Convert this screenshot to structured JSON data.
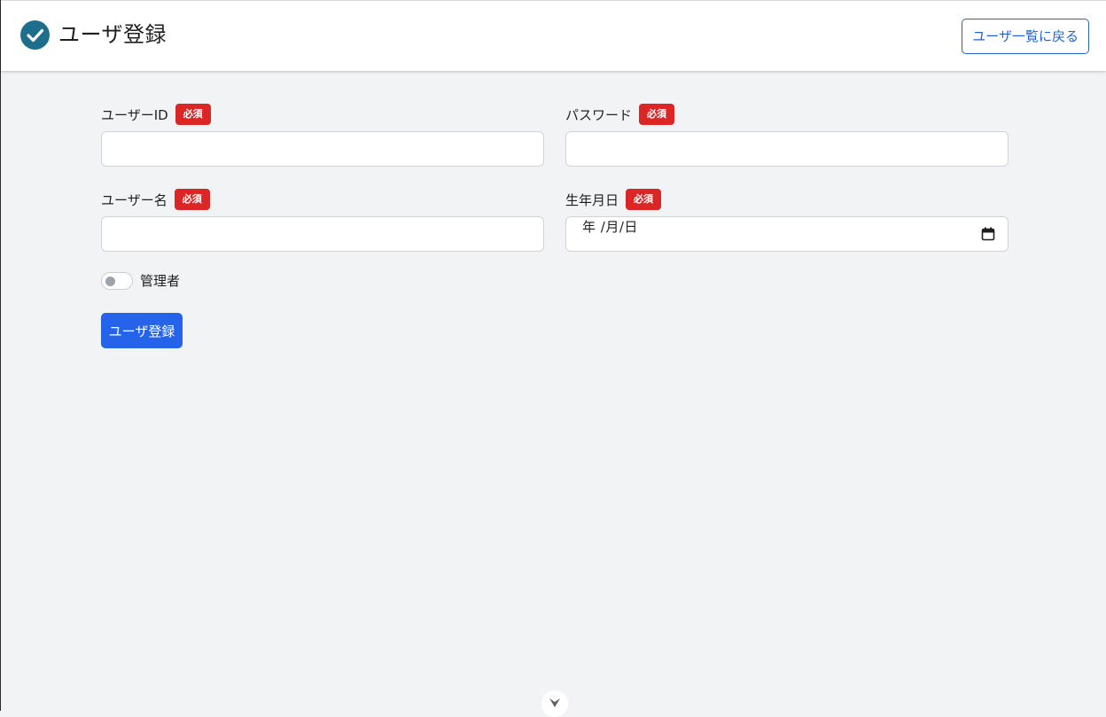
{
  "header": {
    "title": "ユーザ登録",
    "back_button_label": "ユーザ一覧に戻る",
    "icon": "check-circle-icon",
    "accent_color": "#1c6e8c"
  },
  "form": {
    "required_label": "必須",
    "fields": {
      "user_id": {
        "label": "ユーザーID",
        "value": ""
      },
      "password": {
        "label": "パスワード",
        "value": ""
      },
      "user_name": {
        "label": "ユーザー名",
        "value": ""
      },
      "birth_date": {
        "label": "生年月日",
        "display": "年 /月/日"
      }
    },
    "admin_toggle": {
      "label": "管理者",
      "checked": false
    },
    "submit_label": "ユーザ登録"
  },
  "colors": {
    "primary": "#2563eb",
    "required_badge": "#dc2626",
    "background": "#f2f3f5"
  }
}
